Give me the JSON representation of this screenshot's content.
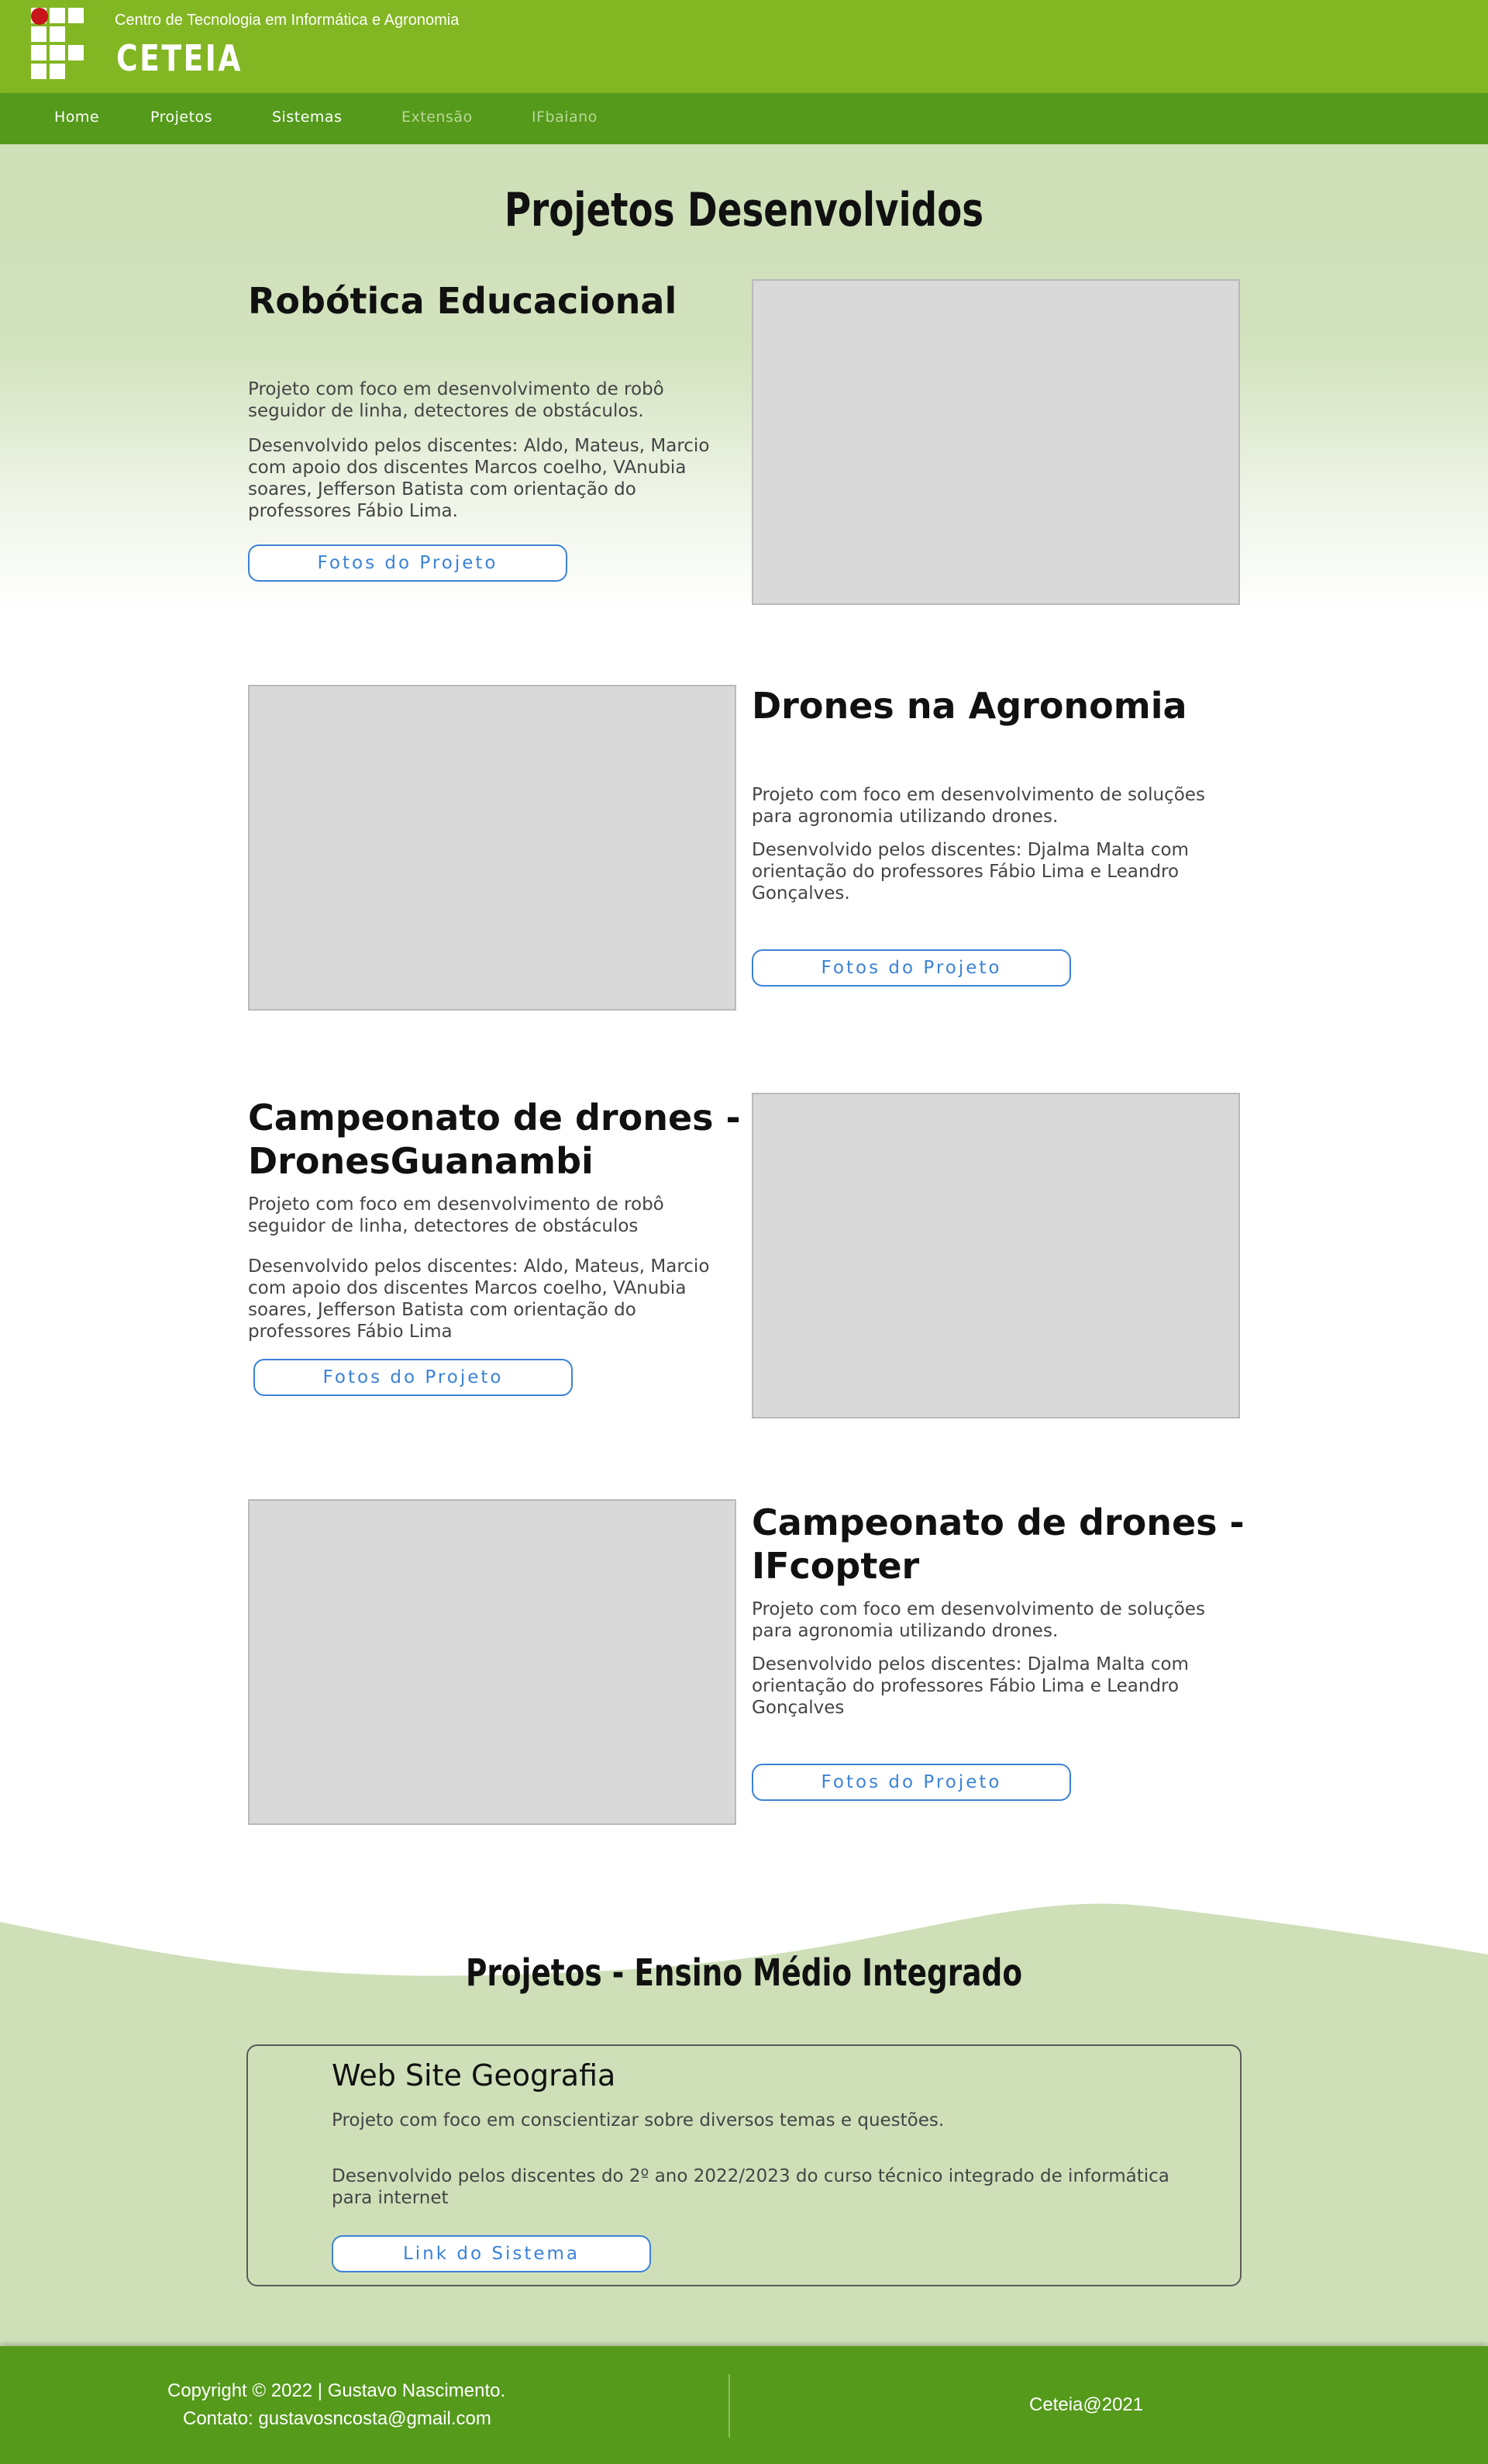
{
  "header": {
    "subtitle": "Centro de Tecnologia em Informática e Agronomia",
    "brand": "CETEIA",
    "logo_icon": "if-baiano-logo-icon",
    "colors": {
      "topbar": "#83b623",
      "navbar": "#559a1b",
      "logo_dot": "#c8141b"
    }
  },
  "nav": {
    "items": [
      {
        "label": "Home"
      },
      {
        "label": "Projetos"
      },
      {
        "label": "Sistemas"
      },
      {
        "label": "Extensão"
      },
      {
        "label": "IFbaiano"
      }
    ]
  },
  "main": {
    "title": "Projetos Desenvolvidos",
    "projects": [
      {
        "title": "Robótica Educacional",
        "description": "Projeto com foco em desenvolvimento de robô seguidor de linha, detectores de obstáculos.",
        "team": "Desenvolvido pelos discentes: Aldo, Mateus, Marcio com apoio dos discentes Marcos coelho, VAnubia soares, Jefferson Batista com orientação do professores Fábio Lima.",
        "button": "Fotos do Projeto"
      },
      {
        "title": "Drones na Agronomia",
        "description": "Projeto com foco em desenvolvimento de soluções para agronomia utilizando drones.",
        "team": "Desenvolvido pelos discentes: Djalma Malta com orientação do professores Fábio Lima e Leandro Gonçalves.",
        "button": "Fotos do Projeto"
      },
      {
        "title": "Campeonato de drones - DronesGuanambi",
        "description": "Projeto com foco em desenvolvimento de robô seguidor de linha, detectores de obstáculos",
        "team": "Desenvolvido pelos discentes: Aldo, Mateus, Marcio com apoio dos discentes Marcos coelho, VAnubia soares, Jefferson Batista com orientação do professores Fábio Lima",
        "button": "Fotos do Projeto"
      },
      {
        "title": "Campeonato de drones - IFcopter",
        "description": "Projeto com foco em desenvolvimento de soluções para agronomia utilizando drones.",
        "team": "Desenvolvido pelos discentes: Djalma Malta com orientação do professores Fábio Lima e Leandro Gonçalves",
        "button": "Fotos do Projeto"
      }
    ]
  },
  "highschool": {
    "title": "Projetos - Ensino Médio Integrado",
    "card": {
      "title": "Web Site Geografia",
      "description": "Projeto com foco em conscientizar sobre diversos temas e questões.",
      "team": "Desenvolvido pelos discentes do 2º ano 2022/2023 do curso técnico integrado de informática para internet",
      "button": "Link do Sistema"
    },
    "colors": {
      "wave": "#cfe0b9"
    }
  },
  "footer": {
    "copyright": "Copyright © 2022 | Gustavo Nascimento.",
    "contact": "Contato: gustavosncosta@gmail.com",
    "tag": "Ceteia@2021"
  }
}
